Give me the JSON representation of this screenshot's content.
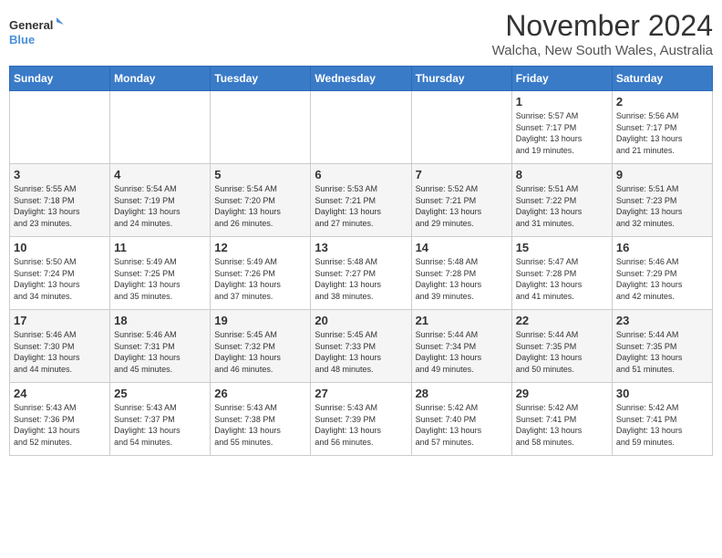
{
  "logo": {
    "line1": "General",
    "line2": "Blue"
  },
  "title": "November 2024",
  "location": "Walcha, New South Wales, Australia",
  "days_of_week": [
    "Sunday",
    "Monday",
    "Tuesday",
    "Wednesday",
    "Thursday",
    "Friday",
    "Saturday"
  ],
  "weeks": [
    [
      {
        "day": "",
        "info": ""
      },
      {
        "day": "",
        "info": ""
      },
      {
        "day": "",
        "info": ""
      },
      {
        "day": "",
        "info": ""
      },
      {
        "day": "",
        "info": ""
      },
      {
        "day": "1",
        "info": "Sunrise: 5:57 AM\nSunset: 7:17 PM\nDaylight: 13 hours\nand 19 minutes."
      },
      {
        "day": "2",
        "info": "Sunrise: 5:56 AM\nSunset: 7:17 PM\nDaylight: 13 hours\nand 21 minutes."
      }
    ],
    [
      {
        "day": "3",
        "info": "Sunrise: 5:55 AM\nSunset: 7:18 PM\nDaylight: 13 hours\nand 23 minutes."
      },
      {
        "day": "4",
        "info": "Sunrise: 5:54 AM\nSunset: 7:19 PM\nDaylight: 13 hours\nand 24 minutes."
      },
      {
        "day": "5",
        "info": "Sunrise: 5:54 AM\nSunset: 7:20 PM\nDaylight: 13 hours\nand 26 minutes."
      },
      {
        "day": "6",
        "info": "Sunrise: 5:53 AM\nSunset: 7:21 PM\nDaylight: 13 hours\nand 27 minutes."
      },
      {
        "day": "7",
        "info": "Sunrise: 5:52 AM\nSunset: 7:21 PM\nDaylight: 13 hours\nand 29 minutes."
      },
      {
        "day": "8",
        "info": "Sunrise: 5:51 AM\nSunset: 7:22 PM\nDaylight: 13 hours\nand 31 minutes."
      },
      {
        "day": "9",
        "info": "Sunrise: 5:51 AM\nSunset: 7:23 PM\nDaylight: 13 hours\nand 32 minutes."
      }
    ],
    [
      {
        "day": "10",
        "info": "Sunrise: 5:50 AM\nSunset: 7:24 PM\nDaylight: 13 hours\nand 34 minutes."
      },
      {
        "day": "11",
        "info": "Sunrise: 5:49 AM\nSunset: 7:25 PM\nDaylight: 13 hours\nand 35 minutes."
      },
      {
        "day": "12",
        "info": "Sunrise: 5:49 AM\nSunset: 7:26 PM\nDaylight: 13 hours\nand 37 minutes."
      },
      {
        "day": "13",
        "info": "Sunrise: 5:48 AM\nSunset: 7:27 PM\nDaylight: 13 hours\nand 38 minutes."
      },
      {
        "day": "14",
        "info": "Sunrise: 5:48 AM\nSunset: 7:28 PM\nDaylight: 13 hours\nand 39 minutes."
      },
      {
        "day": "15",
        "info": "Sunrise: 5:47 AM\nSunset: 7:28 PM\nDaylight: 13 hours\nand 41 minutes."
      },
      {
        "day": "16",
        "info": "Sunrise: 5:46 AM\nSunset: 7:29 PM\nDaylight: 13 hours\nand 42 minutes."
      }
    ],
    [
      {
        "day": "17",
        "info": "Sunrise: 5:46 AM\nSunset: 7:30 PM\nDaylight: 13 hours\nand 44 minutes."
      },
      {
        "day": "18",
        "info": "Sunrise: 5:46 AM\nSunset: 7:31 PM\nDaylight: 13 hours\nand 45 minutes."
      },
      {
        "day": "19",
        "info": "Sunrise: 5:45 AM\nSunset: 7:32 PM\nDaylight: 13 hours\nand 46 minutes."
      },
      {
        "day": "20",
        "info": "Sunrise: 5:45 AM\nSunset: 7:33 PM\nDaylight: 13 hours\nand 48 minutes."
      },
      {
        "day": "21",
        "info": "Sunrise: 5:44 AM\nSunset: 7:34 PM\nDaylight: 13 hours\nand 49 minutes."
      },
      {
        "day": "22",
        "info": "Sunrise: 5:44 AM\nSunset: 7:35 PM\nDaylight: 13 hours\nand 50 minutes."
      },
      {
        "day": "23",
        "info": "Sunrise: 5:44 AM\nSunset: 7:35 PM\nDaylight: 13 hours\nand 51 minutes."
      }
    ],
    [
      {
        "day": "24",
        "info": "Sunrise: 5:43 AM\nSunset: 7:36 PM\nDaylight: 13 hours\nand 52 minutes."
      },
      {
        "day": "25",
        "info": "Sunrise: 5:43 AM\nSunset: 7:37 PM\nDaylight: 13 hours\nand 54 minutes."
      },
      {
        "day": "26",
        "info": "Sunrise: 5:43 AM\nSunset: 7:38 PM\nDaylight: 13 hours\nand 55 minutes."
      },
      {
        "day": "27",
        "info": "Sunrise: 5:43 AM\nSunset: 7:39 PM\nDaylight: 13 hours\nand 56 minutes."
      },
      {
        "day": "28",
        "info": "Sunrise: 5:42 AM\nSunset: 7:40 PM\nDaylight: 13 hours\nand 57 minutes."
      },
      {
        "day": "29",
        "info": "Sunrise: 5:42 AM\nSunset: 7:41 PM\nDaylight: 13 hours\nand 58 minutes."
      },
      {
        "day": "30",
        "info": "Sunrise: 5:42 AM\nSunset: 7:41 PM\nDaylight: 13 hours\nand 59 minutes."
      }
    ]
  ]
}
